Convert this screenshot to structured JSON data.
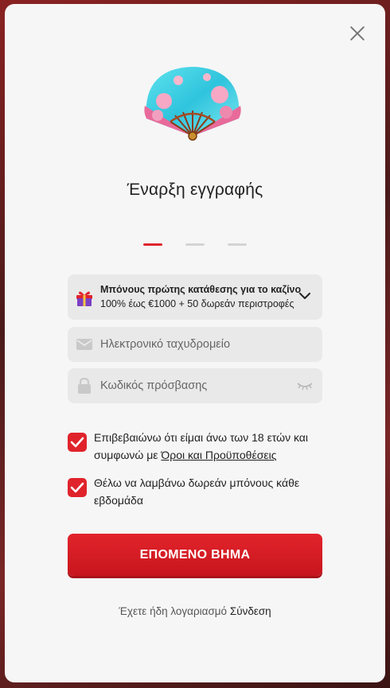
{
  "modal": {
    "title": "Έναρξη εγγραφής",
    "steps": [
      {
        "active": true
      },
      {
        "active": false
      },
      {
        "active": false
      }
    ]
  },
  "bonus": {
    "title": "Μπόνους πρώτης κατάθεσης για το καζίνο",
    "subtitle": "100% έως €1000 + 50 δωρεάν περιστροφές"
  },
  "form": {
    "email_placeholder": "Ηλεκτρονικό ταχυδρομείο",
    "password_placeholder": "Κωδικός πρόσβασης"
  },
  "checks": {
    "age_text": "Επιβεβαιώνω ότι είμαι άνω των 18 ετών και συμφωνώ με",
    "terms_link": "Όροι και Προϋποθέσεις",
    "age_checked": true,
    "bonus_text": "Θέλω να λαμβάνω δωρεάν μπόνους κάθε εβδομάδα",
    "bonus_checked": true
  },
  "cta_label": "ΕΠΟΜΕΝΟ ΒΗΜΑ",
  "login": {
    "prompt": "Έχετε ήδη λογαριασμό",
    "link": "Σύνδεση"
  },
  "colors": {
    "accent": "#e0232b",
    "modal_bg": "#f6f6f6",
    "field_bg": "#e9e9e9"
  },
  "icons": [
    "close-icon",
    "fan-icon",
    "gift-icon",
    "chevron-down-icon",
    "mail-icon",
    "lock-icon",
    "eye-closed-icon",
    "checkmark-icon"
  ]
}
